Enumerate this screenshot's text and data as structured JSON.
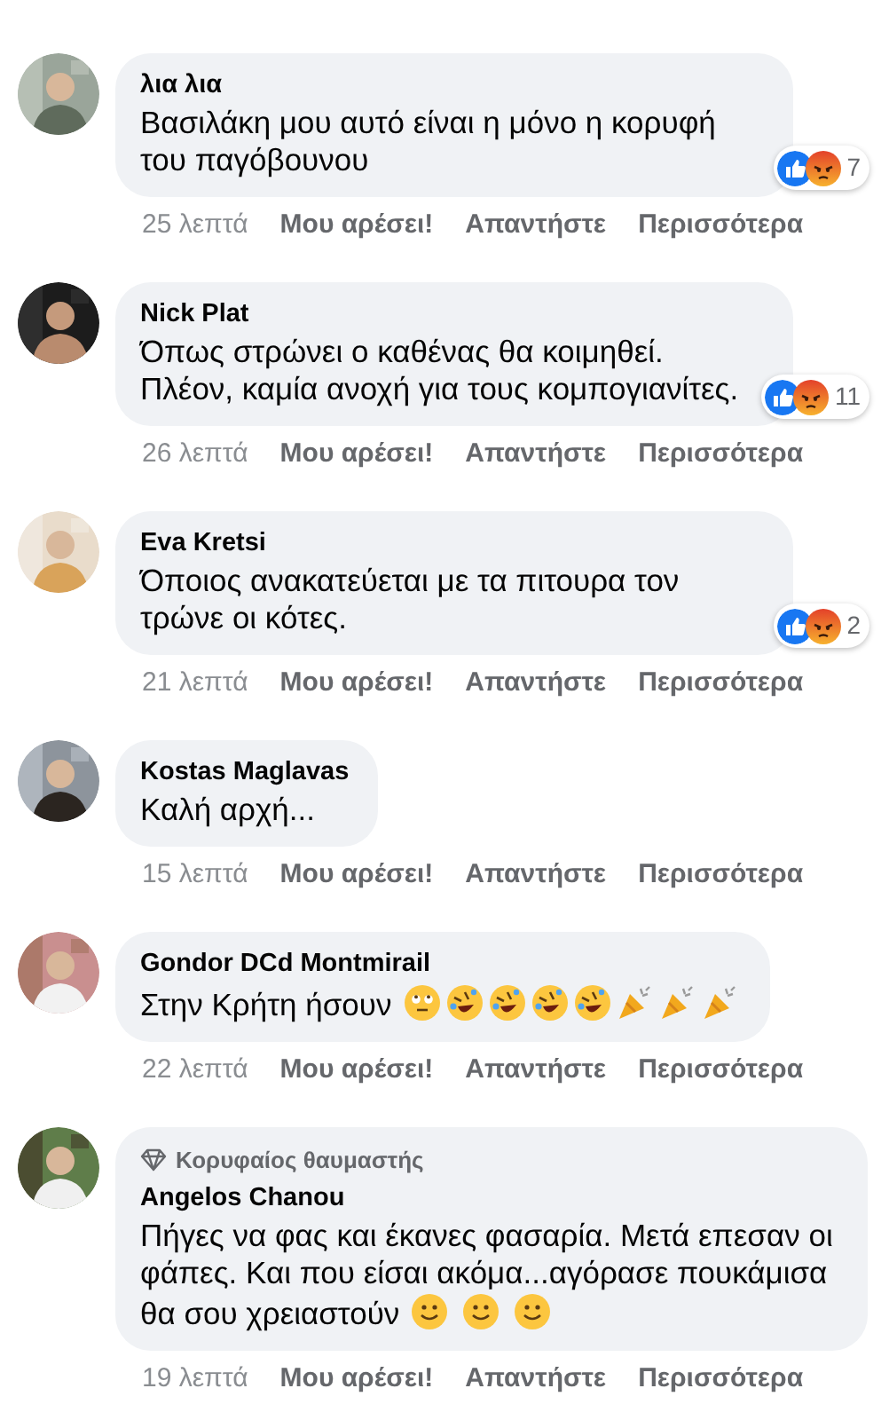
{
  "comments": [
    {
      "author": "λια λια",
      "text": "Βασιλάκη μου αυτό είναι η μόνο η κορυφή του παγόβουνου",
      "reactions": {
        "items": [
          {
            "kind": "like"
          },
          {
            "kind": "angry"
          }
        ],
        "count": "7"
      },
      "time": "25 λεπτά",
      "actions": [
        "Μου αρέσει!",
        "Απαντήστε",
        "Περισσότερα"
      ]
    },
    {
      "author": "Nick Plat",
      "text": "Όπως στρώνει ο καθένας θα κοιμηθεί. Πλέον, καμία ανοχή για τους κομπογιανίτες.",
      "reactions": {
        "items": [
          {
            "kind": "like"
          },
          {
            "kind": "angry"
          }
        ],
        "count": "11"
      },
      "time": "26 λεπτά",
      "actions": [
        "Μου αρέσει!",
        "Απαντήστε",
        "Περισσότερα"
      ]
    },
    {
      "author": "Eva Kretsi",
      "text": "Όποιος ανακατεύεται με τα πιτουρα τον τρώνε οι κότες.",
      "reactions": {
        "items": [
          {
            "kind": "like"
          },
          {
            "kind": "angry"
          }
        ],
        "count": "2"
      },
      "time": "21 λεπτά",
      "actions": [
        "Μου αρέσει!",
        "Απαντήστε",
        "Περισσότερα"
      ]
    },
    {
      "author": "Kostas Maglavas",
      "text": "Καλή αρχή...",
      "time": "15 λεπτά",
      "actions": [
        "Μου αρέσει!",
        "Απαντήστε",
        "Περισσότερα"
      ]
    },
    {
      "author": "Gondor DCd Montmirail",
      "text": "Στην Κρήτη ήσουν",
      "emojis": [
        {
          "kind": "eyeroll"
        },
        {
          "kind": "rofl"
        },
        {
          "kind": "rofl"
        },
        {
          "kind": "rofl"
        },
        {
          "kind": "rofl"
        },
        {
          "kind": "party"
        },
        {
          "kind": "party"
        },
        {
          "kind": "party"
        }
      ],
      "time": "22 λεπτά",
      "actions": [
        "Μου αρέσει!",
        "Απαντήστε",
        "Περισσότερα"
      ]
    },
    {
      "badge": "Κορυφαίος θαυμαστής",
      "author": "Angelos Chanou",
      "text": "Πήγες να φας και έκανες φασαρία. Μετά επεσαν οι φάπες. Και που είσαι ακόμα...αγόρασε πουκάμισα θα σου χρειαστούν",
      "emojis": [
        {
          "kind": "smile"
        },
        {
          "kind": "smile"
        },
        {
          "kind": "smile"
        }
      ],
      "time": "19 λεπτά",
      "actions": [
        "Μου αρέσει!",
        "Απαντήστε",
        "Περισσότερα"
      ]
    }
  ]
}
